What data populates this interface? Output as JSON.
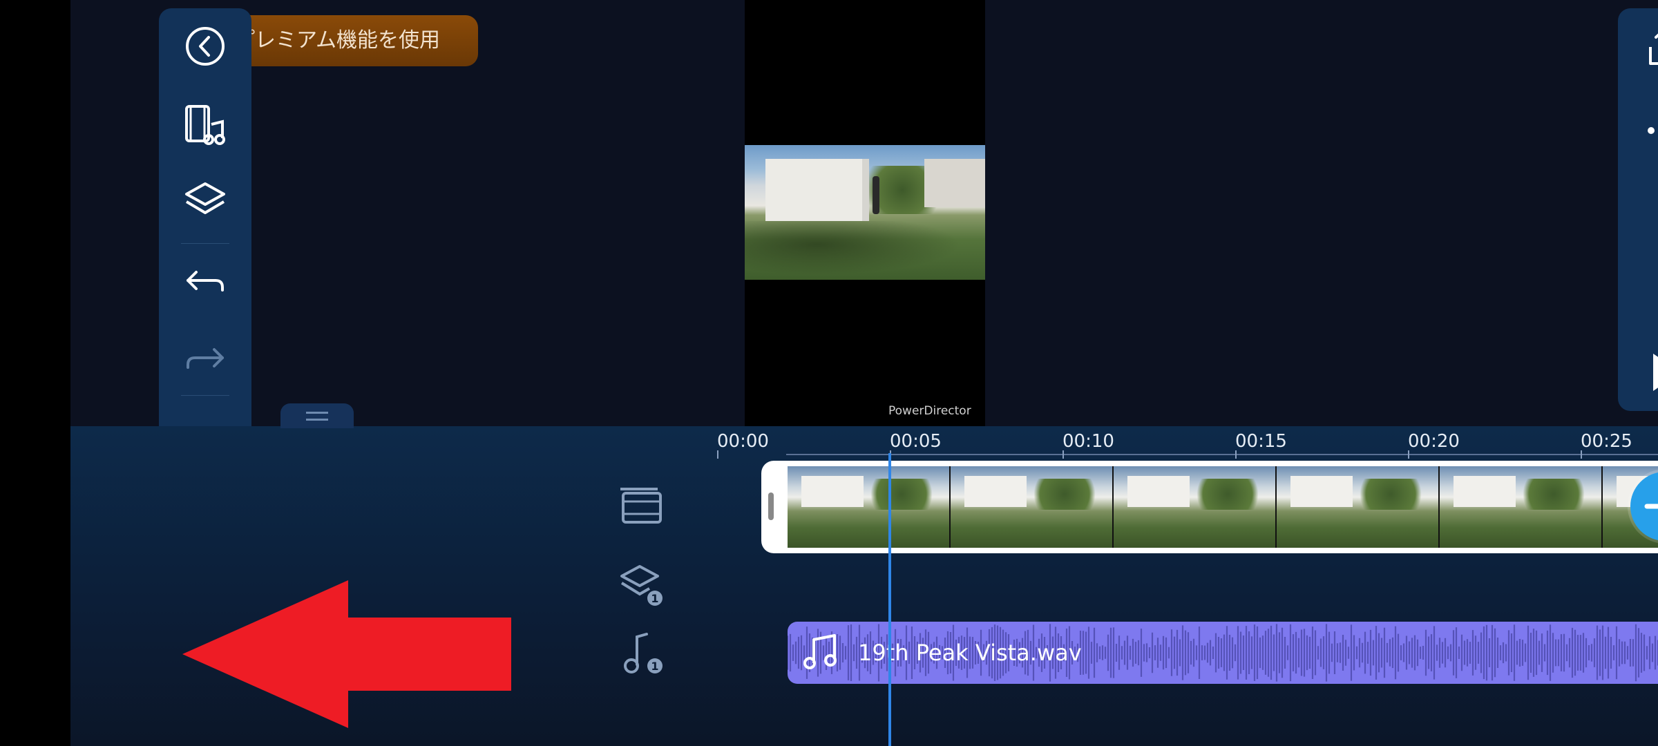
{
  "toolbar": {
    "premium_label": "プレミアム機能を使用"
  },
  "preview": {
    "watermark": "PowerDirector"
  },
  "timeline": {
    "ruler": [
      "00:00",
      "00:05",
      "00:10",
      "00:15",
      "00:20",
      "00:25"
    ],
    "audio_clip_name": "19th Peak Vista.wav",
    "overlay_track_count": "1",
    "audio_track_count": "1"
  },
  "colors": {
    "accent": "#27a0ea",
    "audio_clip": "#7e79ef",
    "premium": "#7a4207",
    "annotation_arrow": "#ee1c25",
    "playhead": "#2f86e8"
  }
}
